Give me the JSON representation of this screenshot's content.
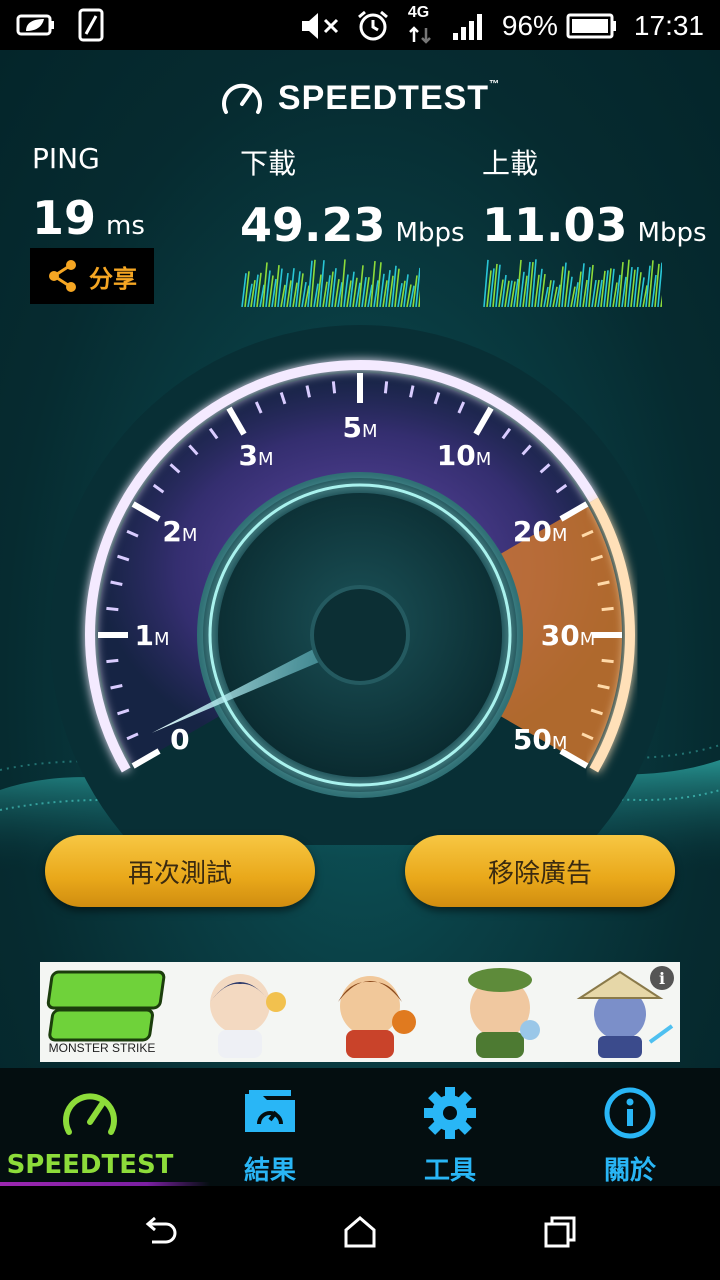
{
  "status_bar": {
    "battery_percent": "96%",
    "time": "17:31",
    "network": "4G",
    "icons": [
      "leaf-battery-saver-icon",
      "sim-card-icon",
      "mute-icon",
      "alarm-icon",
      "network-4g-icon",
      "signal-icon",
      "battery-icon"
    ]
  },
  "header": {
    "brand": "SPEEDTEST",
    "trademark": "™"
  },
  "metrics": {
    "ping": {
      "label": "PING",
      "value": "19",
      "unit": "ms"
    },
    "download": {
      "label": "下載",
      "value": "49.23",
      "unit": "Mbps"
    },
    "upload": {
      "label": "上載",
      "value": "11.03",
      "unit": "Mbps"
    }
  },
  "share": {
    "label": "分享"
  },
  "gauge": {
    "ticks": [
      {
        "num": "0",
        "unit": ""
      },
      {
        "num": "1",
        "unit": "M"
      },
      {
        "num": "2",
        "unit": "M"
      },
      {
        "num": "3",
        "unit": "M"
      },
      {
        "num": "5",
        "unit": "M"
      },
      {
        "num": "10",
        "unit": "M"
      },
      {
        "num": "20",
        "unit": "M"
      },
      {
        "num": "30",
        "unit": "M"
      },
      {
        "num": "50",
        "unit": "M"
      }
    ],
    "needle_fraction": 0.02,
    "highlight_from_tick": 6
  },
  "buttons": {
    "retest": "再次測試",
    "remove_ads": "移除廣告"
  },
  "ad": {
    "logo_sub": "MONSTER STRIKE",
    "info_icon": "info-icon"
  },
  "nav": [
    {
      "label": "SPEEDTEST",
      "icon": "speedometer-icon",
      "active": true
    },
    {
      "label": "結果",
      "icon": "results-folder-icon",
      "active": false
    },
    {
      "label": "工具",
      "icon": "gear-icon",
      "active": false
    },
    {
      "label": "關於",
      "icon": "info-icon",
      "active": false
    }
  ],
  "colors": {
    "accent_green": "#8ddc3a",
    "accent_blue": "#29b6f6",
    "button_gold": "#e9a81a",
    "gauge_orange": "#f08a24",
    "gauge_purple": "#8e5cd8"
  }
}
